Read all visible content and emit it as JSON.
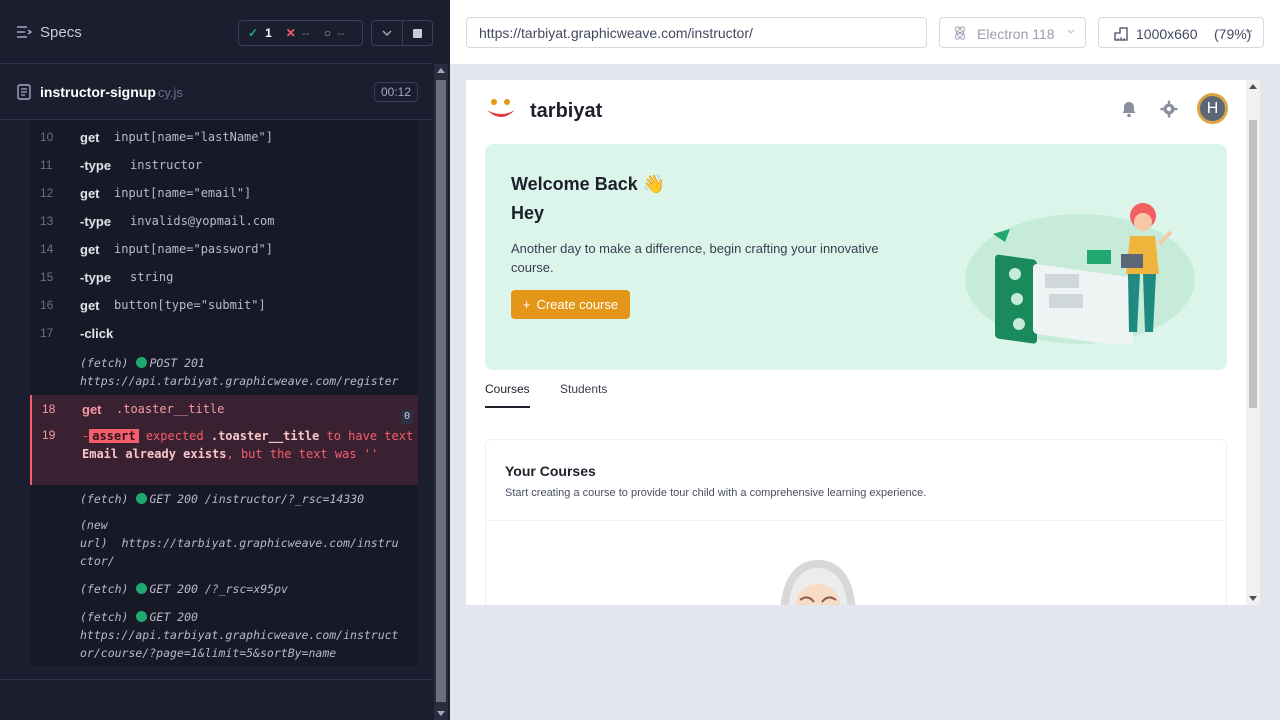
{
  "runner": {
    "specs_label": "Specs",
    "stats": {
      "passed": "1",
      "failed": "--",
      "pending": "--"
    },
    "spec": {
      "name": "instructor-signup",
      "ext": "cy.js",
      "duration": "00:12"
    },
    "commands": [
      {
        "num": "10",
        "name": "get",
        "arg": "input[name=\"lastName\"]"
      },
      {
        "num": "11",
        "name": "-type",
        "arg": "instructor"
      },
      {
        "num": "12",
        "name": "get",
        "arg": "input[name=\"email\"]"
      },
      {
        "num": "13",
        "name": "-type",
        "arg": "invalids@yopmail.com"
      },
      {
        "num": "14",
        "name": "get",
        "arg": "input[name=\"password\"]"
      },
      {
        "num": "15",
        "name": "-type",
        "arg": "string"
      },
      {
        "num": "16",
        "name": "get",
        "arg": "button[type=\"submit\"]"
      },
      {
        "num": "17",
        "name": "-click",
        "arg": ""
      }
    ],
    "log1": {
      "kind": "(fetch)",
      "status": "POST 201",
      "url": "https://api.tarbiyat.graphicweave.com/register"
    },
    "failed": {
      "num18": "18",
      "name18": "get",
      "arg18": ".toaster__title",
      "retry": "0",
      "num19": "19",
      "dash": "-",
      "assert_tag": "assert",
      "expected": "expected",
      "selector": ".toaster__title",
      "to_have": "to have",
      "text_word": "text",
      "message": "Email already exists",
      "but": ", but the text was",
      "quotes": "''"
    },
    "log2": {
      "kind": "(fetch)",
      "status": "GET 200 /instructor/?_rsc=14330"
    },
    "log3": {
      "kind1": "(new",
      "kind2": "url)",
      "url1": "https://tarbiyat.graphicweave.com/instru",
      "url2": "ctor/"
    },
    "log4": {
      "kind": "(fetch)",
      "status": "GET 200 /?_rsc=x95pv"
    },
    "log5": {
      "kind": "(fetch)",
      "status": "GET 200",
      "url1": "https://api.tarbiyat.graphicweave.com/instruct",
      "url2": "or/course/?page=1&limit=5&sortBy=name"
    }
  },
  "browser": {
    "url": "https://tarbiyat.graphicweave.com/instructor/",
    "browser_name": "Electron 118",
    "viewport": "1000x660",
    "zoom": "(79%)"
  },
  "app": {
    "brand": "tarbiyat",
    "avatar_initial": "H",
    "hero": {
      "title": "Welcome Back 👋",
      "subtitle": "Hey",
      "description": "Another day to make a difference, begin crafting your innovative course.",
      "button_label": "Create course"
    },
    "tabs": [
      {
        "label": "Courses",
        "active": true
      },
      {
        "label": "Students",
        "active": false
      }
    ],
    "courses": {
      "title": "Your Courses",
      "description": "Start creating a course to provide tour child with a comprehensive learning experience."
    }
  },
  "colors": {
    "runner_bg": "#1b1e2e",
    "pass": "#1fa971",
    "fail": "#f55f6b",
    "hero_bg": "#dcf5ea",
    "accent": "#e39617"
  }
}
